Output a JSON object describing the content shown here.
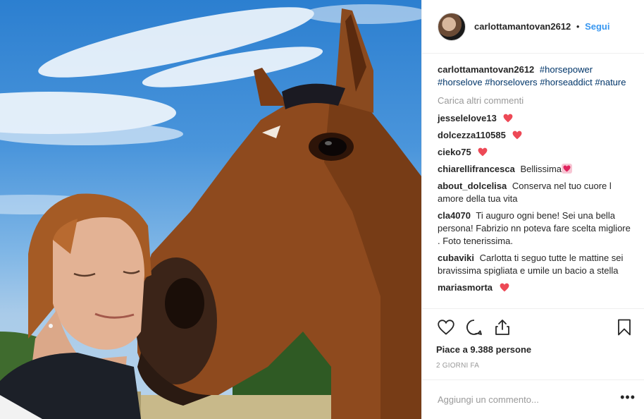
{
  "post": {
    "username": "carlottamantovan2612",
    "follow_label": "Segui",
    "separator": "•",
    "caption": {
      "username": "carlottamantovan2612",
      "hashtags": [
        "#horsepower",
        "#horselove",
        "#horselovers",
        "#horseaddict",
        "#nature"
      ]
    },
    "load_more_label": "Carica altri commenti",
    "comments": [
      {
        "user": "jesselelove13",
        "text": "",
        "heart": true
      },
      {
        "user": "dolcezza110585",
        "text": "",
        "heart": true
      },
      {
        "user": "cieko75",
        "text": "",
        "heart": true
      },
      {
        "user": "chiarellifrancesca",
        "text": "Bellissima",
        "emoji_heart": true
      },
      {
        "user": "about_dolcelisa",
        "text": "Conserva nel tuo cuore l amore della tua vita"
      },
      {
        "user": "cla4070",
        "text": "Ti auguro ogni bene! Sei una bella persona! Fabrizio nn poteva fare scelta migliore . Foto tenerissima."
      },
      {
        "user": "cubaviki",
        "text": "Carlotta ti seguo tutte le mattine sei bravissima spigliata e umile un bacio a stella"
      },
      {
        "user": "mariasmorta",
        "text": "",
        "heart": true
      }
    ],
    "likes_label": "Piace a 9.388 persone",
    "date_label": "2 GIORNI FA",
    "add_comment_placeholder": "Aggiungi un commento...",
    "more_label": "•••",
    "icons": {
      "like": "heart-outline-icon",
      "comment": "comment-bubble-icon",
      "share": "share-upload-icon",
      "save": "bookmark-icon"
    },
    "colors": {
      "link": "#3897f0",
      "hashtag": "#003569",
      "muted": "#999999",
      "heart": "#ed4956"
    }
  }
}
